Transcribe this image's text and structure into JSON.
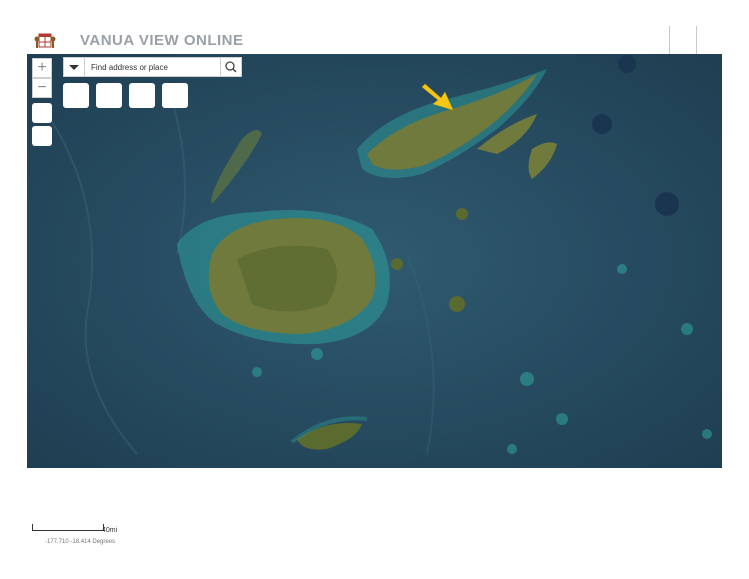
{
  "header": {
    "title": "VANUA VIEW ONLINE",
    "logo_icon": "fiji-coat-of-arms-icon"
  },
  "map": {
    "zoom_in_label": "+",
    "zoom_out_label": "−",
    "search": {
      "placeholder": "Find address or place",
      "dropdown_icon": "caret-down-icon",
      "search_icon": "magnifier-icon"
    },
    "colors": {
      "ocean": "#2a4d63",
      "land": "#6f7a3c",
      "reef": "#2e9e9a",
      "arrow": "#f5c518"
    }
  },
  "footer": {
    "scale_label": "40mi",
    "coordinates": "-177.710 -18.414 Degrees"
  }
}
